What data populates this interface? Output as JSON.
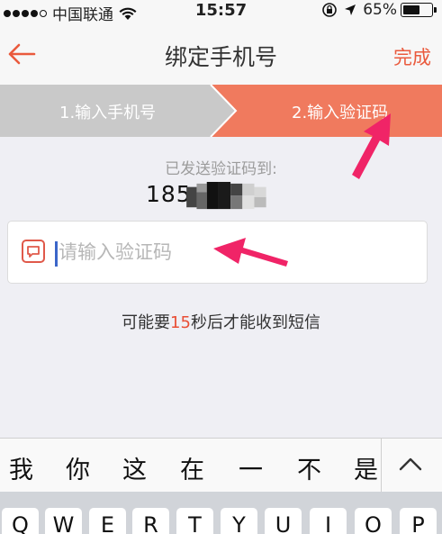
{
  "status_bar": {
    "carrier": "中国联通",
    "time": "15:57",
    "battery": "65%",
    "battery_level": 0.65,
    "icons": [
      "signal-dots-icon",
      "wifi-icon",
      "rotation-lock-icon",
      "location-arrow-icon",
      "battery-icon"
    ]
  },
  "nav": {
    "back_icon": "arrow-left-icon",
    "title": "绑定手机号",
    "done": "完成",
    "accent": "#ea5a3d"
  },
  "steps": [
    {
      "label": "1.输入手机号",
      "active": false,
      "color": "#c9c9c9"
    },
    {
      "label": "2.输入验证码",
      "active": true,
      "color": "#f07a5e"
    }
  ],
  "content": {
    "sent_label": "已发送验证码到:",
    "phone_visible": "185",
    "code_input": {
      "icon": "sms-icon",
      "value": "",
      "placeholder": "请输入验证码"
    },
    "hint_prefix": "可能要",
    "hint_seconds": "15",
    "hint_suffix": "秒后才能收到短信",
    "hint_seconds_color": "#e94e35"
  },
  "annotations": {
    "arrow_color": "#f02467"
  },
  "keyboard": {
    "candidates": [
      "我",
      "你",
      "这",
      "在",
      "一",
      "不",
      "是"
    ],
    "expand_icon": "chevron-up-icon",
    "keys_row1": [
      "Q",
      "W",
      "E",
      "R",
      "T",
      "Y",
      "U",
      "I",
      "O",
      "P"
    ]
  }
}
